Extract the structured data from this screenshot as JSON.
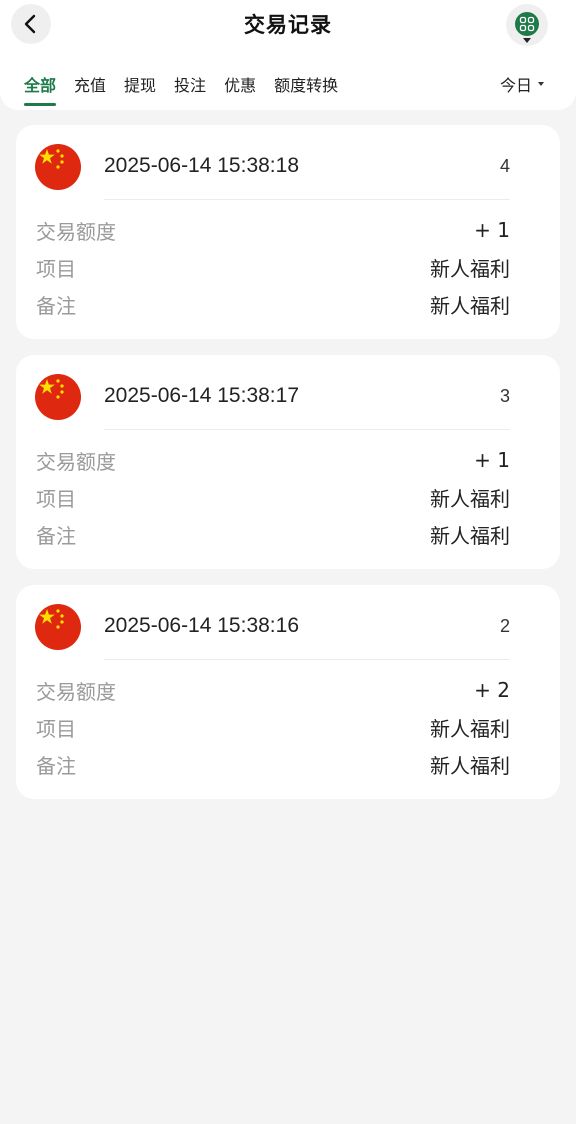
{
  "header": {
    "title": "交易记录"
  },
  "tabs": [
    {
      "label": "全部",
      "active": true
    },
    {
      "label": "充值",
      "active": false
    },
    {
      "label": "提现",
      "active": false
    },
    {
      "label": "投注",
      "active": false
    },
    {
      "label": "优惠",
      "active": false
    },
    {
      "label": "额度转换",
      "active": false
    }
  ],
  "date_filter": {
    "value": "今日"
  },
  "colors": {
    "accent": "#1f7a4a",
    "flag_red": "#de2910",
    "flag_yellow": "#ffde00"
  },
  "records": [
    {
      "datetime": "2025-06-14 15:38:18",
      "seq": "4",
      "amount_label": "交易额度",
      "amount": "+ 1",
      "item_label": "项目",
      "item": "新人福利",
      "note_label": "备注",
      "note": "新人福利"
    },
    {
      "datetime": "2025-06-14 15:38:17",
      "seq": "3",
      "amount_label": "交易额度",
      "amount": "+ 1",
      "item_label": "项目",
      "item": "新人福利",
      "note_label": "备注",
      "note": "新人福利"
    },
    {
      "datetime": "2025-06-14 15:38:16",
      "seq": "2",
      "amount_label": "交易额度",
      "amount": "+ 2",
      "item_label": "项目",
      "item": "新人福利",
      "note_label": "备注",
      "note": "新人福利"
    }
  ]
}
